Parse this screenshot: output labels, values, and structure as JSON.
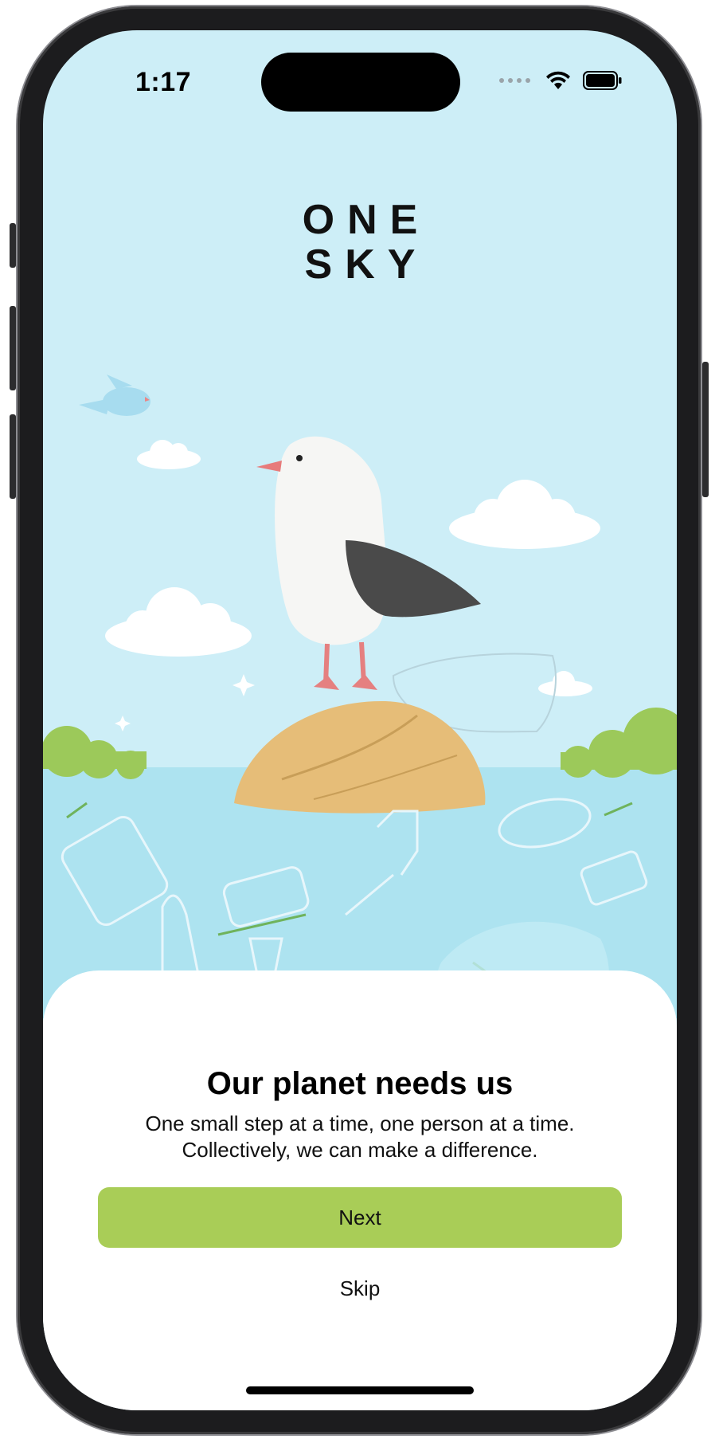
{
  "status_bar": {
    "time": "1:17"
  },
  "logo": {
    "line1": "ONE",
    "line2": "SKY"
  },
  "onboarding": {
    "headline": "Our planet needs us",
    "body_line1": "One small step at a time, one person at a time.",
    "body_line2": "Collectively, we can make a difference.",
    "next_label": "Next",
    "skip_label": "Skip"
  },
  "colors": {
    "sky": "#cdeef7",
    "water": "#ade3f0",
    "next_button": "#a9cd57",
    "sheet": "#ffffff"
  },
  "icons": [
    "wifi-icon",
    "battery-icon",
    "signal-dots-icon"
  ]
}
